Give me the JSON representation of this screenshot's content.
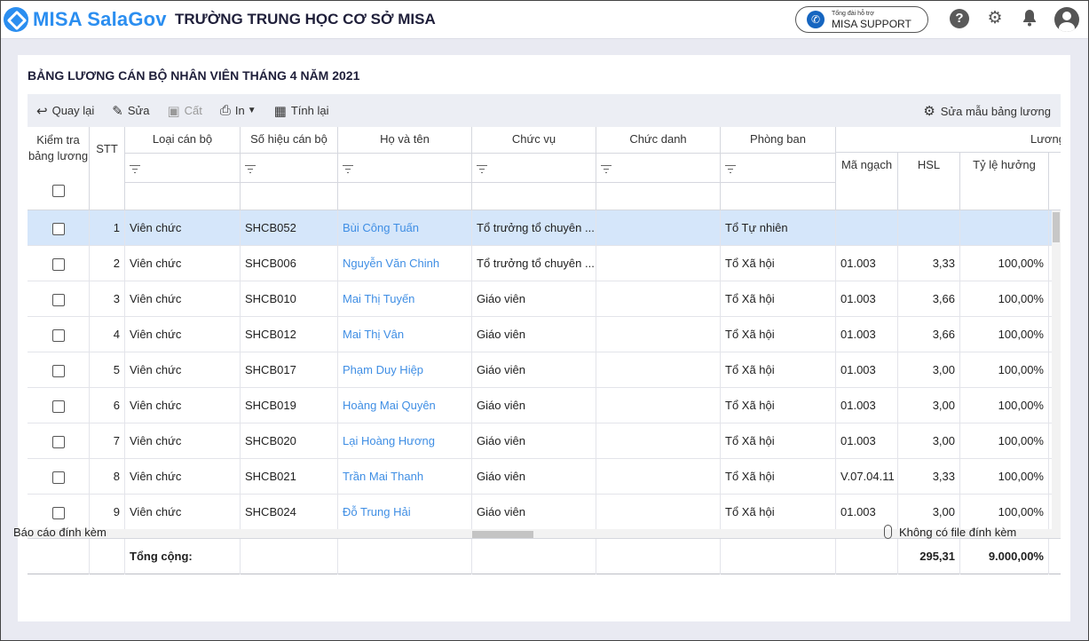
{
  "header": {
    "brand": "MISA SalaGov",
    "school": "TRƯỜNG TRUNG HỌC CƠ SỞ MISA",
    "support_small": "Tổng đài hỗ trợ",
    "support_big": "MISA SUPPORT",
    "icons": [
      "help-icon",
      "gear-icon",
      "bell-icon",
      "avatar-icon"
    ]
  },
  "page": {
    "title": "BẢNG LƯƠNG CÁN BỘ NHÂN VIÊN THÁNG 4 NĂM 2021"
  },
  "toolbar": {
    "back": "Quay lại",
    "edit": "Sửa",
    "save": "Cất",
    "print": "In",
    "recalc": "Tính lại",
    "edit_template": "Sửa mẫu bảng lương"
  },
  "table": {
    "columns": {
      "check": "Kiểm tra bảng lương",
      "stt": "STT",
      "type": "Loại cán bộ",
      "code": "Số hiệu cán bộ",
      "name": "Họ và tên",
      "position": "Chức vụ",
      "title": "Chức danh",
      "dept": "Phòng ban",
      "salary_group": "Lương",
      "rank_code": "Mã ngạch",
      "hsl": "HSL",
      "ratio": "Tỷ lệ hưởng"
    },
    "rows": [
      {
        "stt": "1",
        "type": "Viên chức",
        "code": "SHCB052",
        "name": "Bùi Công Tuấn",
        "position": "Tổ trưởng tổ chuyên ...",
        "title": "",
        "dept": "Tổ Tự nhiên",
        "rank": "",
        "hsl": "",
        "ratio": ""
      },
      {
        "stt": "2",
        "type": "Viên chức",
        "code": "SHCB006",
        "name": "Nguyễn Văn Chinh",
        "position": "Tổ trưởng tổ chuyên ...",
        "title": "",
        "dept": "Tổ Xã hội",
        "rank": "01.003",
        "hsl": "3,33",
        "ratio": "100,00%"
      },
      {
        "stt": "3",
        "type": "Viên chức",
        "code": "SHCB010",
        "name": "Mai Thị Tuyến",
        "position": "Giáo viên",
        "title": "",
        "dept": "Tổ Xã hội",
        "rank": "01.003",
        "hsl": "3,66",
        "ratio": "100,00%"
      },
      {
        "stt": "4",
        "type": "Viên chức",
        "code": "SHCB012",
        "name": "Mai Thị Vân",
        "position": "Giáo viên",
        "title": "",
        "dept": "Tổ Xã hội",
        "rank": "01.003",
        "hsl": "3,66",
        "ratio": "100,00%"
      },
      {
        "stt": "5",
        "type": "Viên chức",
        "code": "SHCB017",
        "name": "Phạm Duy Hiệp",
        "position": "Giáo viên",
        "title": "",
        "dept": "Tổ Xã hội",
        "rank": "01.003",
        "hsl": "3,00",
        "ratio": "100,00%"
      },
      {
        "stt": "6",
        "type": "Viên chức",
        "code": "SHCB019",
        "name": "Hoàng Mai Quyên",
        "position": "Giáo viên",
        "title": "",
        "dept": "Tổ Xã hội",
        "rank": "01.003",
        "hsl": "3,00",
        "ratio": "100,00%"
      },
      {
        "stt": "7",
        "type": "Viên chức",
        "code": "SHCB020",
        "name": "Lại Hoàng Hương",
        "position": "Giáo viên",
        "title": "",
        "dept": "Tổ Xã hội",
        "rank": "01.003",
        "hsl": "3,00",
        "ratio": "100,00%"
      },
      {
        "stt": "8",
        "type": "Viên chức",
        "code": "SHCB021",
        "name": "Trần Mai Thanh",
        "position": "Giáo viên",
        "title": "",
        "dept": "Tổ Xã hội",
        "rank": "V.07.04.11",
        "hsl": "3,33",
        "ratio": "100,00%"
      },
      {
        "stt": "9",
        "type": "Viên chức",
        "code": "SHCB024",
        "name": "Đỗ Trung Hải",
        "position": "Giáo viên",
        "title": "",
        "dept": "Tổ Xã hội",
        "rank": "01.003",
        "hsl": "3,00",
        "ratio": "100,00%"
      }
    ],
    "total": {
      "label": "Tổng cộng:",
      "hsl": "295,31",
      "ratio": "9.000,00%"
    }
  },
  "footer": {
    "attach_label": "Báo cáo đính kèm",
    "no_file": "Không có file đính kèm"
  }
}
